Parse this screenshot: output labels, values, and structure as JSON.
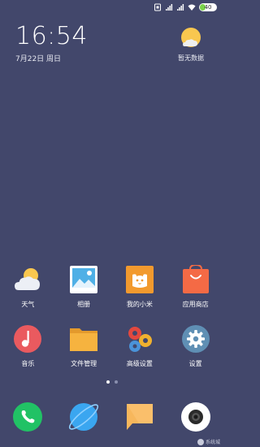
{
  "status_bar": {
    "battery_level": "40",
    "icons": [
      "sim-card-icon",
      "signal-1-icon",
      "signal-2-icon",
      "wifi-icon",
      "battery-icon"
    ]
  },
  "clock": {
    "time": "16:54",
    "date": "7月22日 周日"
  },
  "weather_widget": {
    "icon": "sun-cloud-icon",
    "text": "暂无数据"
  },
  "home_apps": [
    [
      {
        "label": "天气",
        "icon": "weather-icon"
      },
      {
        "label": "相册",
        "icon": "gallery-icon"
      },
      {
        "label": "我的小米",
        "icon": "mi-account-icon"
      },
      {
        "label": "应用商店",
        "icon": "app-store-icon"
      }
    ],
    [
      {
        "label": "音乐",
        "icon": "music-icon"
      },
      {
        "label": "文件管理",
        "icon": "file-manager-icon"
      },
      {
        "label": "高级设置",
        "icon": "advanced-settings-icon"
      },
      {
        "label": "设置",
        "icon": "settings-icon"
      }
    ]
  ],
  "page_indicator": {
    "pages": 2,
    "active": 1
  },
  "dock": [
    {
      "icon": "phone-icon"
    },
    {
      "icon": "browser-icon"
    },
    {
      "icon": "messages-icon"
    },
    {
      "icon": "camera-icon"
    }
  ],
  "watermark": {
    "text": "系统城"
  },
  "colors": {
    "wallpaper": "#42476b",
    "phone": "#21c265",
    "browser": "#3aa6f0",
    "messages": "#f7b75c",
    "music": "#ea5a5f",
    "files": "#f6b33f",
    "settings": "#5f8fb4",
    "app_store": "#f46a45",
    "mi_account": "#f29a2e"
  }
}
